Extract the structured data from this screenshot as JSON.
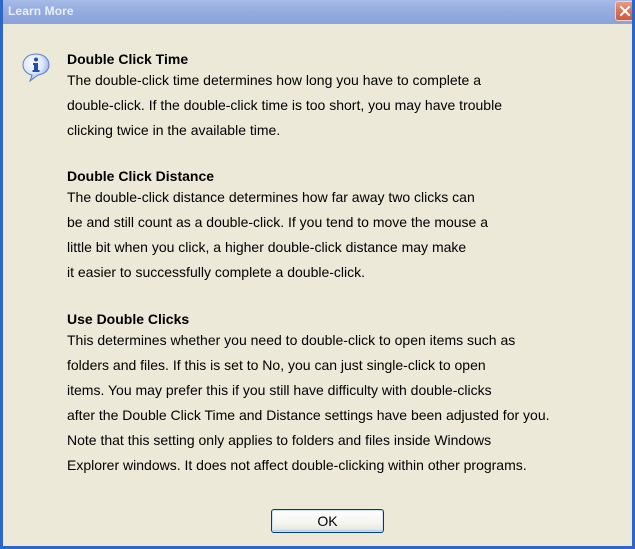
{
  "window": {
    "title": "Learn More"
  },
  "sections": [
    {
      "heading": "Double Click Time",
      "lines": [
        "The double-click time determines how long you have to complete a",
        "double-click. If the double-click time is too short, you may have trouble",
        "clicking twice in the available time."
      ]
    },
    {
      "heading": "Double Click Distance",
      "lines": [
        "The double-click distance determines how far away two clicks can",
        "be and still count as a double-click. If you tend to move the mouse a",
        "little bit when you click, a higher double-click distance may make",
        "it easier to successfully complete a double-click."
      ]
    },
    {
      "heading": "Use Double Clicks",
      "lines": [
        "This determines whether you need to double-click to open items such as",
        "folders and files. If this is set to No, you can just single-click to open",
        "items. You may prefer this if you still have difficulty with double-clicks",
        "after the Double Click Time and Distance settings have been adjusted for you.",
        "Note that this setting only applies to folders and files inside Windows",
        "Explorer windows.  It does not affect double-clicking within other programs."
      ]
    }
  ],
  "buttons": {
    "ok_label": "OK"
  },
  "icons": {
    "info": "info-icon",
    "close": "close-icon"
  },
  "colors": {
    "window_border": "#2d65c9",
    "titlebar": "#95acdf",
    "close_button": "#d96b50",
    "dialog_background": "#ece9d8"
  }
}
